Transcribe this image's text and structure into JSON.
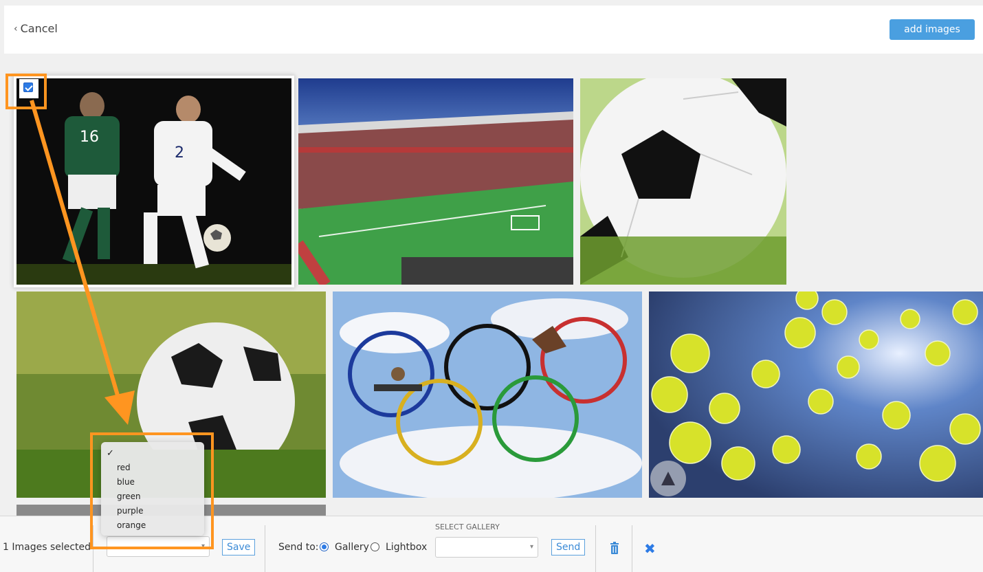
{
  "header": {
    "cancel_label": "Cancel",
    "add_images_label": "add images"
  },
  "color_dropdown": {
    "selected_index": 0,
    "options": [
      "",
      "red",
      "blue",
      "green",
      "purple",
      "orange"
    ]
  },
  "bottom_bar": {
    "selection_count_text": "1 Images selected",
    "save_label": "Save",
    "send_to_label": "Send to:",
    "radio_gallery_label": "Gallery",
    "radio_lightbox_label": "Lightbox",
    "selected_destination": "Gallery",
    "select_gallery_caption": "SELECT GALLERY",
    "gallery_select_value": "",
    "send_label": "Send"
  },
  "colors": {
    "accent_blue": "#4a9fe0",
    "annotation_orange": "#ff9520"
  },
  "icons": {
    "cancel": "chevron-left-icon",
    "delete": "trash-icon",
    "close": "close-x-icon"
  }
}
